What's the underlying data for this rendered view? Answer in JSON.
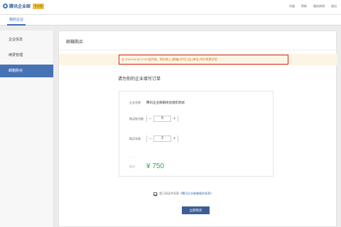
{
  "header": {
    "logo_text": "腾讯企业邮",
    "logo_badge": "专业版",
    "links": [
      "升级",
      "帮助",
      "服务热线",
      "退出"
    ]
  },
  "subnav": {
    "tab": "我的企业"
  },
  "sidebar": {
    "items": [
      {
        "label": "企业信息",
        "active": false
      },
      {
        "label": "续费管理",
        "active": false
      },
      {
        "label": "邮箱购买",
        "active": true
      }
    ]
  },
  "main": {
    "title": "邮箱购买",
    "notice": "从 2019-04-18 17:00 起开始，到年底上 [邮箱] 时付门店 [单位] 时付免费试用",
    "form_heading": "请为你的企业填写订单",
    "form": {
      "company_label": "企业名称",
      "company_value": "腾讯企业邮箱体验组织测试",
      "accounts_label": "购买账号数",
      "accounts_value": "5",
      "years_label": "购买年限",
      "years_value": "2",
      "dots": "……",
      "total_label": "总计：",
      "total_value": "¥ 750"
    },
    "agreement_text": "我已阅读并同意",
    "agreement_link": "《腾讯企业邮箱服务条款》",
    "submit_label": "立即购买"
  },
  "colors": {
    "accent": "#4773b5",
    "notice_bg": "#fcf5e4",
    "notice_border": "#e02020",
    "price": "#2fa84f"
  }
}
